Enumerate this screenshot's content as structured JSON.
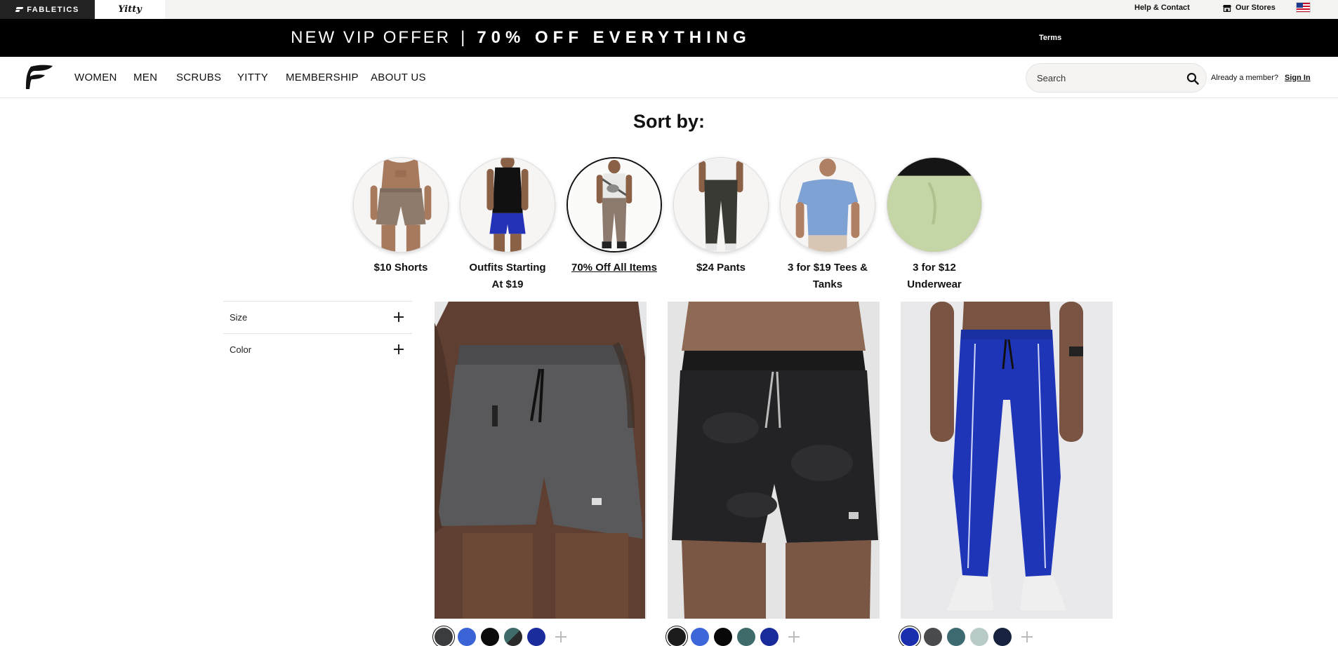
{
  "utility": {
    "fabletics_label": "FABLETICS",
    "yitty_label": "Yitty",
    "help_label": "Help & Contact",
    "stores_label": "Our Stores"
  },
  "promo": {
    "left_text": "NEW VIP OFFER",
    "separator": "|",
    "bold_text": "70% OFF EVERYTHING",
    "terms_label": "Terms"
  },
  "nav": {
    "items": [
      "WOMEN",
      "MEN",
      "SCRUBS",
      "YITTY",
      "MEMBERSHIP",
      "ABOUT US"
    ],
    "search_placeholder": "Search",
    "member_text": "Already a member?",
    "signin_label": "Sign In"
  },
  "sort": {
    "title": "Sort by:",
    "items": [
      {
        "label_1": "$10 Shorts",
        "label_2": "",
        "active": false
      },
      {
        "label_1": "Outfits Starting",
        "label_2": "At $19",
        "active": false
      },
      {
        "label_1": "70% Off All Items",
        "label_2": "",
        "active": true
      },
      {
        "label_1": "$24 Pants",
        "label_2": "",
        "active": false
      },
      {
        "label_1": "3 for $19 Tees &",
        "label_2": "Tanks",
        "active": false
      },
      {
        "label_1": "3 for $12",
        "label_2": "Underwear",
        "active": false
      }
    ]
  },
  "filters": {
    "size_label": "Size",
    "color_label": "Color"
  },
  "products": [
    {
      "swatches": [
        "#3b3c3e",
        "#3a63d6",
        "#0b0b0b",
        "#3f6b6a",
        "#1a2c9c"
      ]
    },
    {
      "swatches": [
        "#1c1c1c",
        "#3d66d8",
        "#080808",
        "#3f6b6a",
        "#1a2c9c"
      ]
    },
    {
      "swatches": [
        "#1b2fae",
        "#4a4b4d",
        "#3d6a70",
        "#b9cbc9",
        "#16223e"
      ]
    }
  ],
  "colors": {
    "promo_bg": "#000000",
    "utility_bg": "#f3f3f1",
    "text": "#111111"
  }
}
